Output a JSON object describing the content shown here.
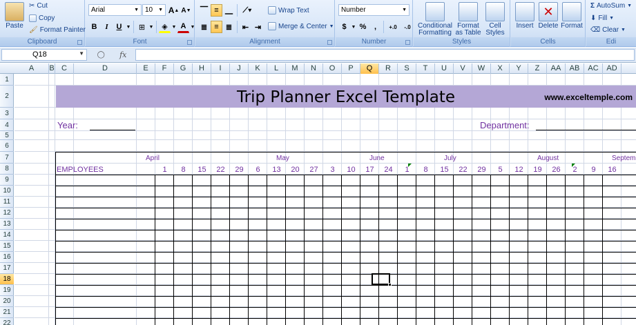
{
  "ribbon": {
    "clipboard": {
      "paste": "Paste",
      "cut": "Cut",
      "copy": "Copy",
      "format_painter": "Format Painter",
      "label": "Clipboard"
    },
    "font": {
      "name": "Arial",
      "size": "10",
      "grow": "A",
      "shrink": "A",
      "bold": "B",
      "italic": "I",
      "underline": "U",
      "label": "Font",
      "font_color": "#cc0000"
    },
    "alignment": {
      "wrap_text": "Wrap Text",
      "merge_center": "Merge & Center",
      "label": "Alignment"
    },
    "number": {
      "format": "Number",
      "currency": "$",
      "percent": "%",
      "comma": ",",
      "inc_decimal": "+.0",
      "dec_decimal": "-.0",
      "label": "Number"
    },
    "styles": {
      "conditional": "Conditional",
      "conditional2": "Formatting",
      "format_table": "Format",
      "format_table2": "as Table",
      "cell_styles": "Cell",
      "cell_styles2": "Styles",
      "label": "Styles"
    },
    "cells": {
      "insert": "Insert",
      "delete": "Delete",
      "format": "Format",
      "label": "Cells"
    },
    "editing": {
      "autosum": "AutoSum",
      "fill": "Fill",
      "clear": "Clear",
      "label": "Edi"
    }
  },
  "formula_bar": {
    "name_box": "Q18",
    "fx": "fx",
    "content": ""
  },
  "columns": [
    "A",
    "B",
    "C",
    "D",
    "E",
    "F",
    "G",
    "H",
    "I",
    "J",
    "K",
    "L",
    "M",
    "N",
    "O",
    "P",
    "Q",
    "R",
    "S",
    "T",
    "U",
    "V",
    "W",
    "X",
    "Y",
    "Z",
    "AA",
    "AB",
    "AC",
    "AD"
  ],
  "selected_column": "Q",
  "rows": [
    "1",
    "2",
    "3",
    "4",
    "5",
    "6",
    "7",
    "8",
    "9",
    "10",
    "11",
    "12",
    "13",
    "14",
    "15",
    "16",
    "17",
    "18",
    "19",
    "20",
    "21",
    "22"
  ],
  "selected_row": "18",
  "sheet": {
    "title": "Trip Planner Excel Template",
    "website": "www.exceltemple.com",
    "year_label": "Year:",
    "department_label": "Department:",
    "employees_label": "EMPLOYEES",
    "months": [
      "April",
      "May",
      "June",
      "July",
      "August",
      "September"
    ],
    "days": [
      "1",
      "8",
      "15",
      "22",
      "29",
      "6",
      "13",
      "20",
      "27",
      "3",
      "10",
      "17",
      "24",
      "1",
      "8",
      "15",
      "22",
      "29",
      "5",
      "12",
      "19",
      "26",
      "2",
      "9",
      "16"
    ],
    "title_band_color": "#b4a7d6",
    "label_color": "#7030a0"
  }
}
